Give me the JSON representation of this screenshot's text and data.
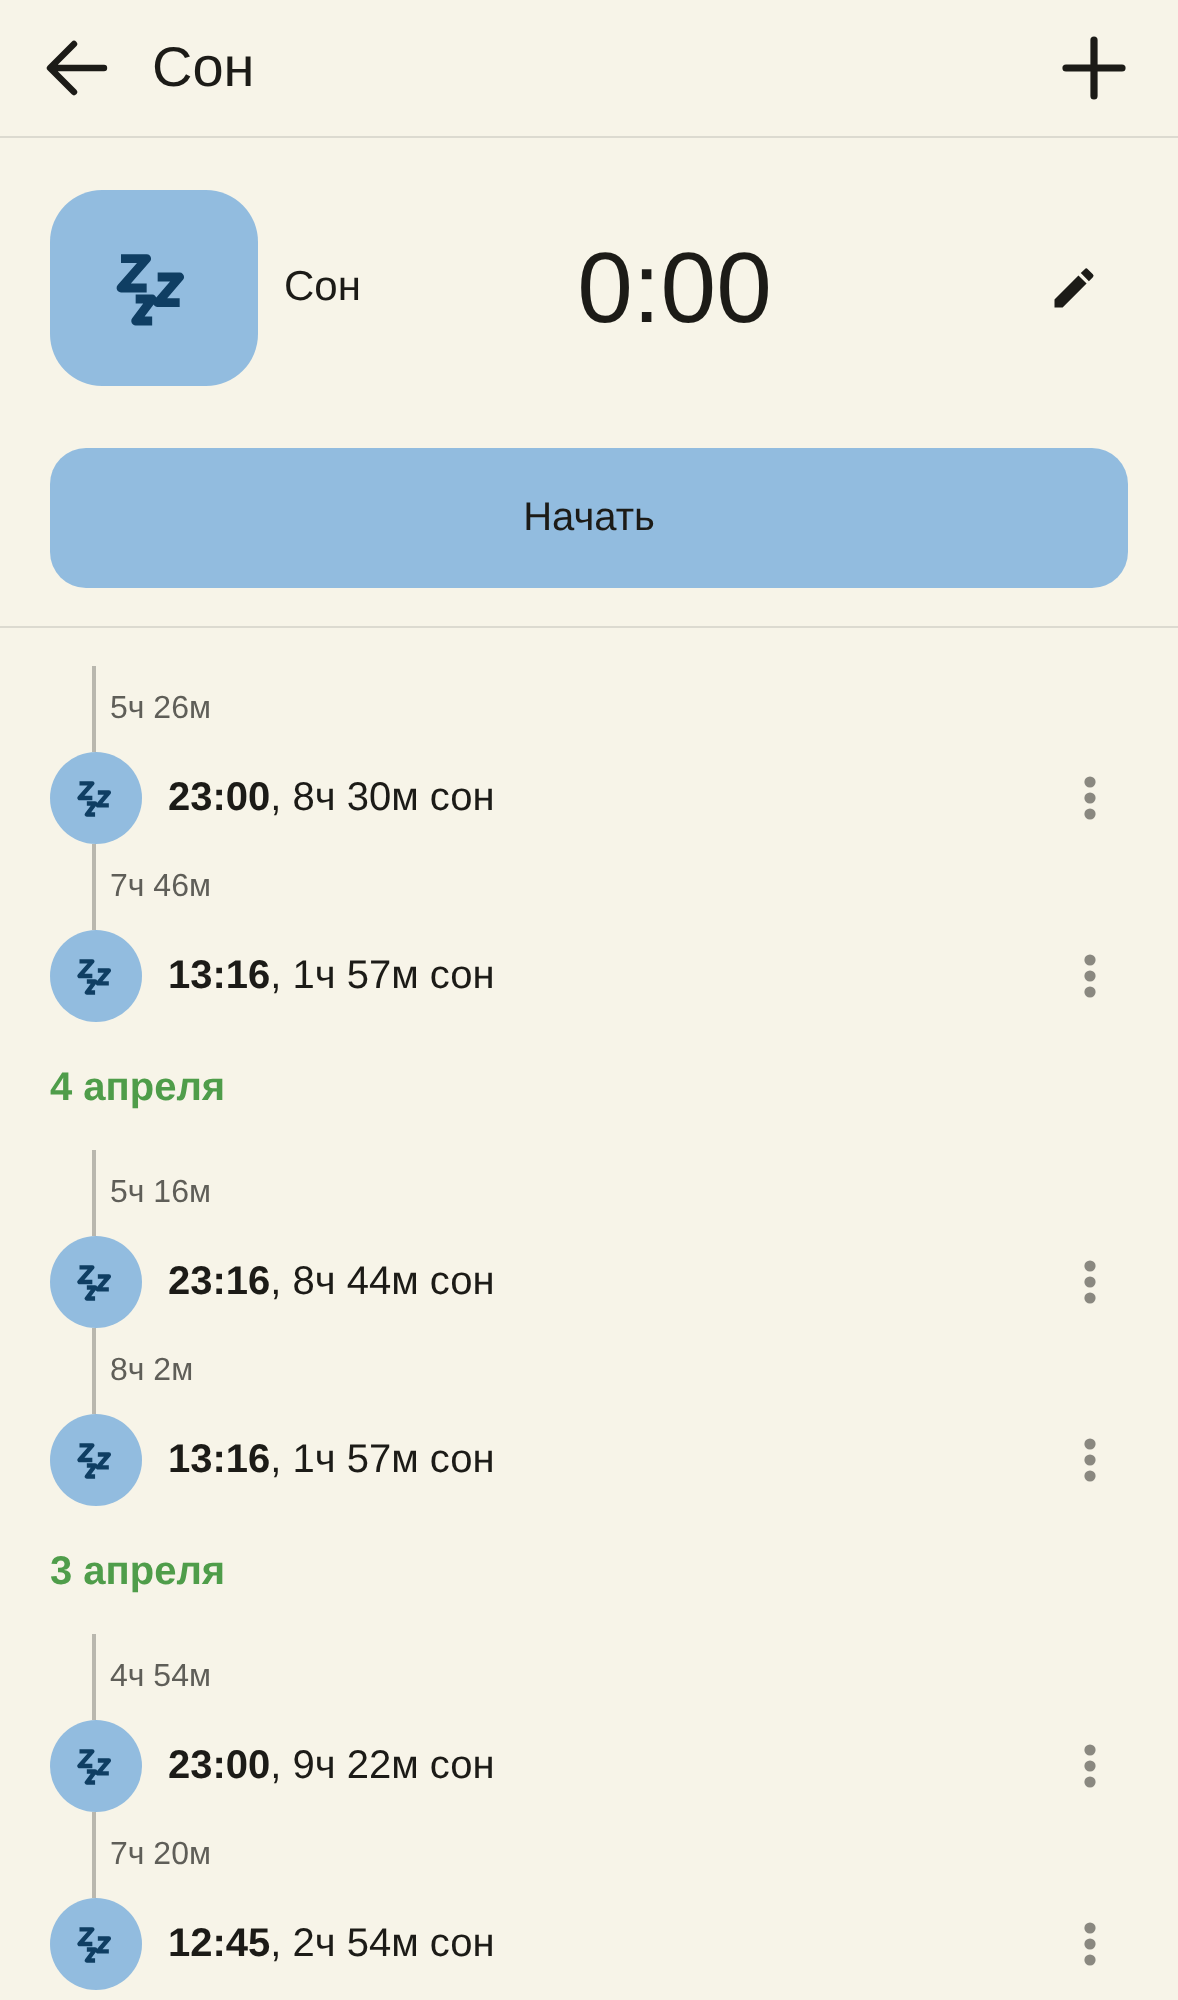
{
  "top_bar": {
    "title": "Сон"
  },
  "activity": {
    "name": "Сон",
    "timer": "0:00",
    "start_button": "Начать"
  },
  "groups": [
    {
      "entries": [
        {
          "gap": "5ч 26м",
          "text": "**23:00**, 8ч 30м сон"
        },
        {
          "gap": "7ч 46м",
          "text": "**13:16**, 1ч 57м сон"
        }
      ]
    },
    {
      "date": "4 апреля",
      "entries": [
        {
          "gap": "5ч 16м",
          "text": "**23:16**, 8ч 44м сон"
        },
        {
          "gap": "8ч 2м",
          "text": "**13:16**, 1ч 57м сон"
        }
      ]
    },
    {
      "date": "3 апреля",
      "entries": [
        {
          "gap": "4ч 54м",
          "text": "**23:00**, 9ч 22м сон"
        },
        {
          "gap": "7ч 20м",
          "text": "**12:45**, 2ч 54м сон"
        }
      ]
    }
  ]
}
